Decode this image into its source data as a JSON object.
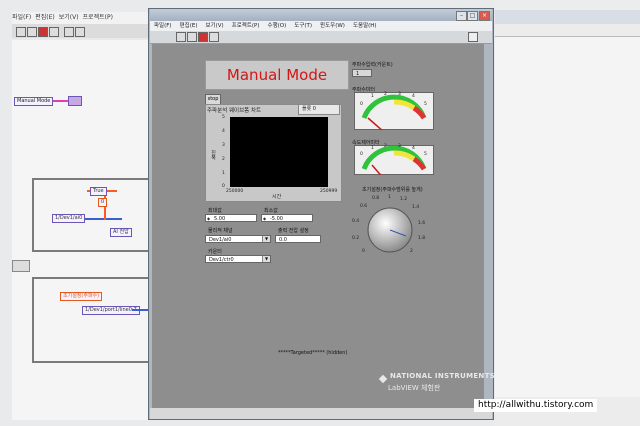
{
  "front_panel": {
    "toolbar_icons": [
      "run-arrow-icon",
      "run-continuous-icon",
      "abort-icon",
      "pause-icon"
    ],
    "mode_display": "Manual Mode",
    "stop_button": "stop",
    "chart": {
      "title": "주파분석 웨이브폼 차트",
      "legend": "플롯 0",
      "y_ticks": [
        "5",
        "4",
        "3",
        "2",
        "1",
        "0"
      ],
      "x_min": "250000",
      "x_max": "250999",
      "xlabel": "시간",
      "ylabel": "진폭"
    },
    "numeric_1": {
      "label": "최대값",
      "value": "5.00"
    },
    "numeric_2": {
      "label": "최소값",
      "value": "-5.00"
    },
    "channel_label": "물리적 채널",
    "channel_value": "Dev1/ai0",
    "sample_label": "출력 전압 설정",
    "sample_value": "0.0",
    "counter_label": "카운터",
    "counter_value": "Dev1/ctr0",
    "right_indicator_label": "주파수입력(카운트)",
    "right_indicator_value": "1",
    "gauge1_label": "주파수미터",
    "gauge2_label": "속도제어미터",
    "knob_label": "초기설정(주파수범위를 높게)",
    "knob_ticks": [
      "0",
      "0.2",
      "0.4",
      "0.6",
      "0.8",
      "1",
      "1.2",
      "1.4",
      "1.6",
      "1.8",
      "2"
    ],
    "gauge_ticks": [
      "0",
      "1",
      "2",
      "3",
      "4",
      "5"
    ],
    "hidden_note": "*****Targeted***** (hidden)",
    "brand_line1": "NATIONAL INSTRUMENTS",
    "brand_line2": "LabVIEW  체험판"
  },
  "block_diagram": {
    "node_manual": "Manual Mode",
    "node_dev_ai": "1/Dev1/ai0",
    "node_dev_port": "1/Dev1/port1/line0:7",
    "node_ai": "AI 전압",
    "node_true": "True",
    "node_zero": "0",
    "node_init": "초기설정(주파수)"
  },
  "url": "http://allwithu.tistory.com"
}
